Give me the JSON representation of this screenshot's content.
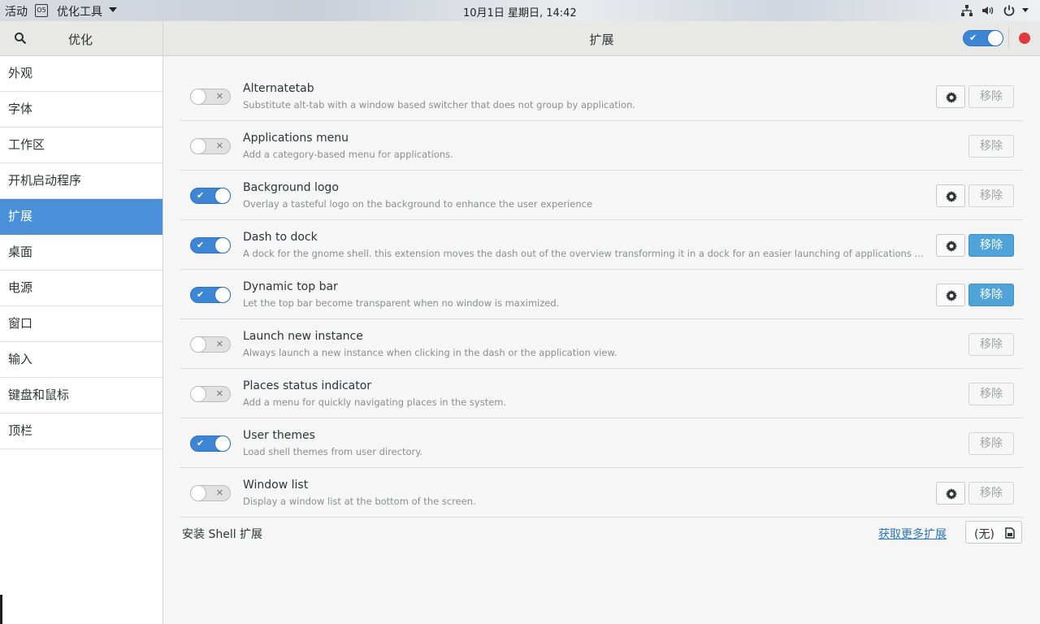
{
  "topbar": {
    "activities": "活动",
    "app_icon_text": "O5",
    "app_name": "优化工具",
    "clock": "10月1日 星期日, 14:42",
    "icons": [
      "network-icon",
      "volume-icon",
      "power-icon"
    ]
  },
  "sidebar": {
    "title": "优化",
    "items": [
      {
        "label": "外观"
      },
      {
        "label": "字体"
      },
      {
        "label": "工作区"
      },
      {
        "label": "开机启动程序"
      },
      {
        "label": "扩展",
        "active": true
      },
      {
        "label": "桌面"
      },
      {
        "label": "电源"
      },
      {
        "label": "窗口"
      },
      {
        "label": "输入"
      },
      {
        "label": "键盘和鼠标"
      },
      {
        "label": "顶栏"
      }
    ]
  },
  "header": {
    "title": "扩展",
    "master_switch": "on"
  },
  "extensions": [
    {
      "name": "Alternatetab",
      "description": "Substitute alt-tab with a window based switcher that does not group by application.",
      "enabled": false,
      "has_settings": true,
      "remove_label": "移除",
      "removable": false
    },
    {
      "name": "Applications menu",
      "description": "Add a category-based menu for applications.",
      "enabled": false,
      "has_settings": false,
      "remove_label": "移除",
      "removable": false
    },
    {
      "name": "Background logo",
      "description": "Overlay a tasteful logo on the background to enhance the user experience",
      "enabled": true,
      "has_settings": true,
      "remove_label": "移除",
      "removable": false
    },
    {
      "name": "Dash to dock",
      "description": "A dock for the gnome shell. this extension moves the dash out of the overview transforming it in a dock for an easier launching of applications and a faster s…",
      "enabled": true,
      "has_settings": true,
      "remove_label": "移除",
      "removable": true
    },
    {
      "name": "Dynamic top bar",
      "description": "Let the top bar become transparent when no window is maximized.",
      "enabled": true,
      "has_settings": true,
      "remove_label": "移除",
      "removable": true
    },
    {
      "name": "Launch new instance",
      "description": "Always launch a new instance when clicking in the dash or the application view.",
      "enabled": false,
      "has_settings": false,
      "remove_label": "移除",
      "removable": false
    },
    {
      "name": "Places status indicator",
      "description": "Add a menu for quickly navigating places in the system.",
      "enabled": false,
      "has_settings": false,
      "remove_label": "移除",
      "removable": false
    },
    {
      "name": "User themes",
      "description": "Load shell themes from user directory.",
      "enabled": true,
      "has_settings": false,
      "remove_label": "移除",
      "removable": false
    },
    {
      "name": "Window list",
      "description": "Display a window list at the bottom of the screen.",
      "enabled": false,
      "has_settings": true,
      "remove_label": "移除",
      "removable": false
    }
  ],
  "footer": {
    "install_label": "安装 Shell 扩展",
    "more_link": "获取更多扩展",
    "file_chooser_value": "(无)"
  },
  "colors": {
    "accent": "#4a90d9",
    "switch_on": "#3d86d6",
    "remove_enabled": "#4fa3d9",
    "close_button": "#e0393e"
  }
}
